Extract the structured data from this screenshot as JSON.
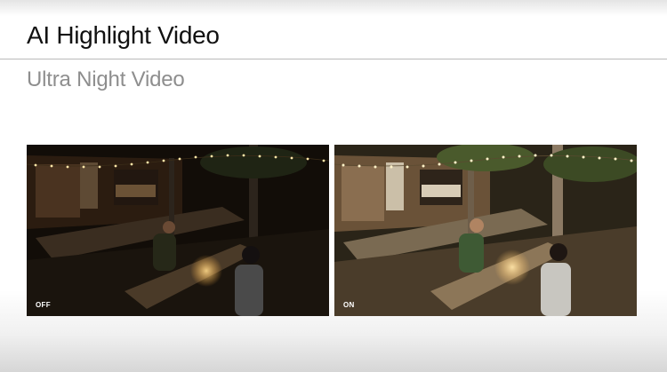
{
  "slide": {
    "title": "AI Highlight Video",
    "subtitle": "Ultra Night Video"
  },
  "comparison": {
    "left_label": "OFF",
    "right_label": "ON"
  },
  "colors": {
    "title": "#111111",
    "subtitle": "#8e8e8e",
    "divider": "#b9b9b9"
  }
}
